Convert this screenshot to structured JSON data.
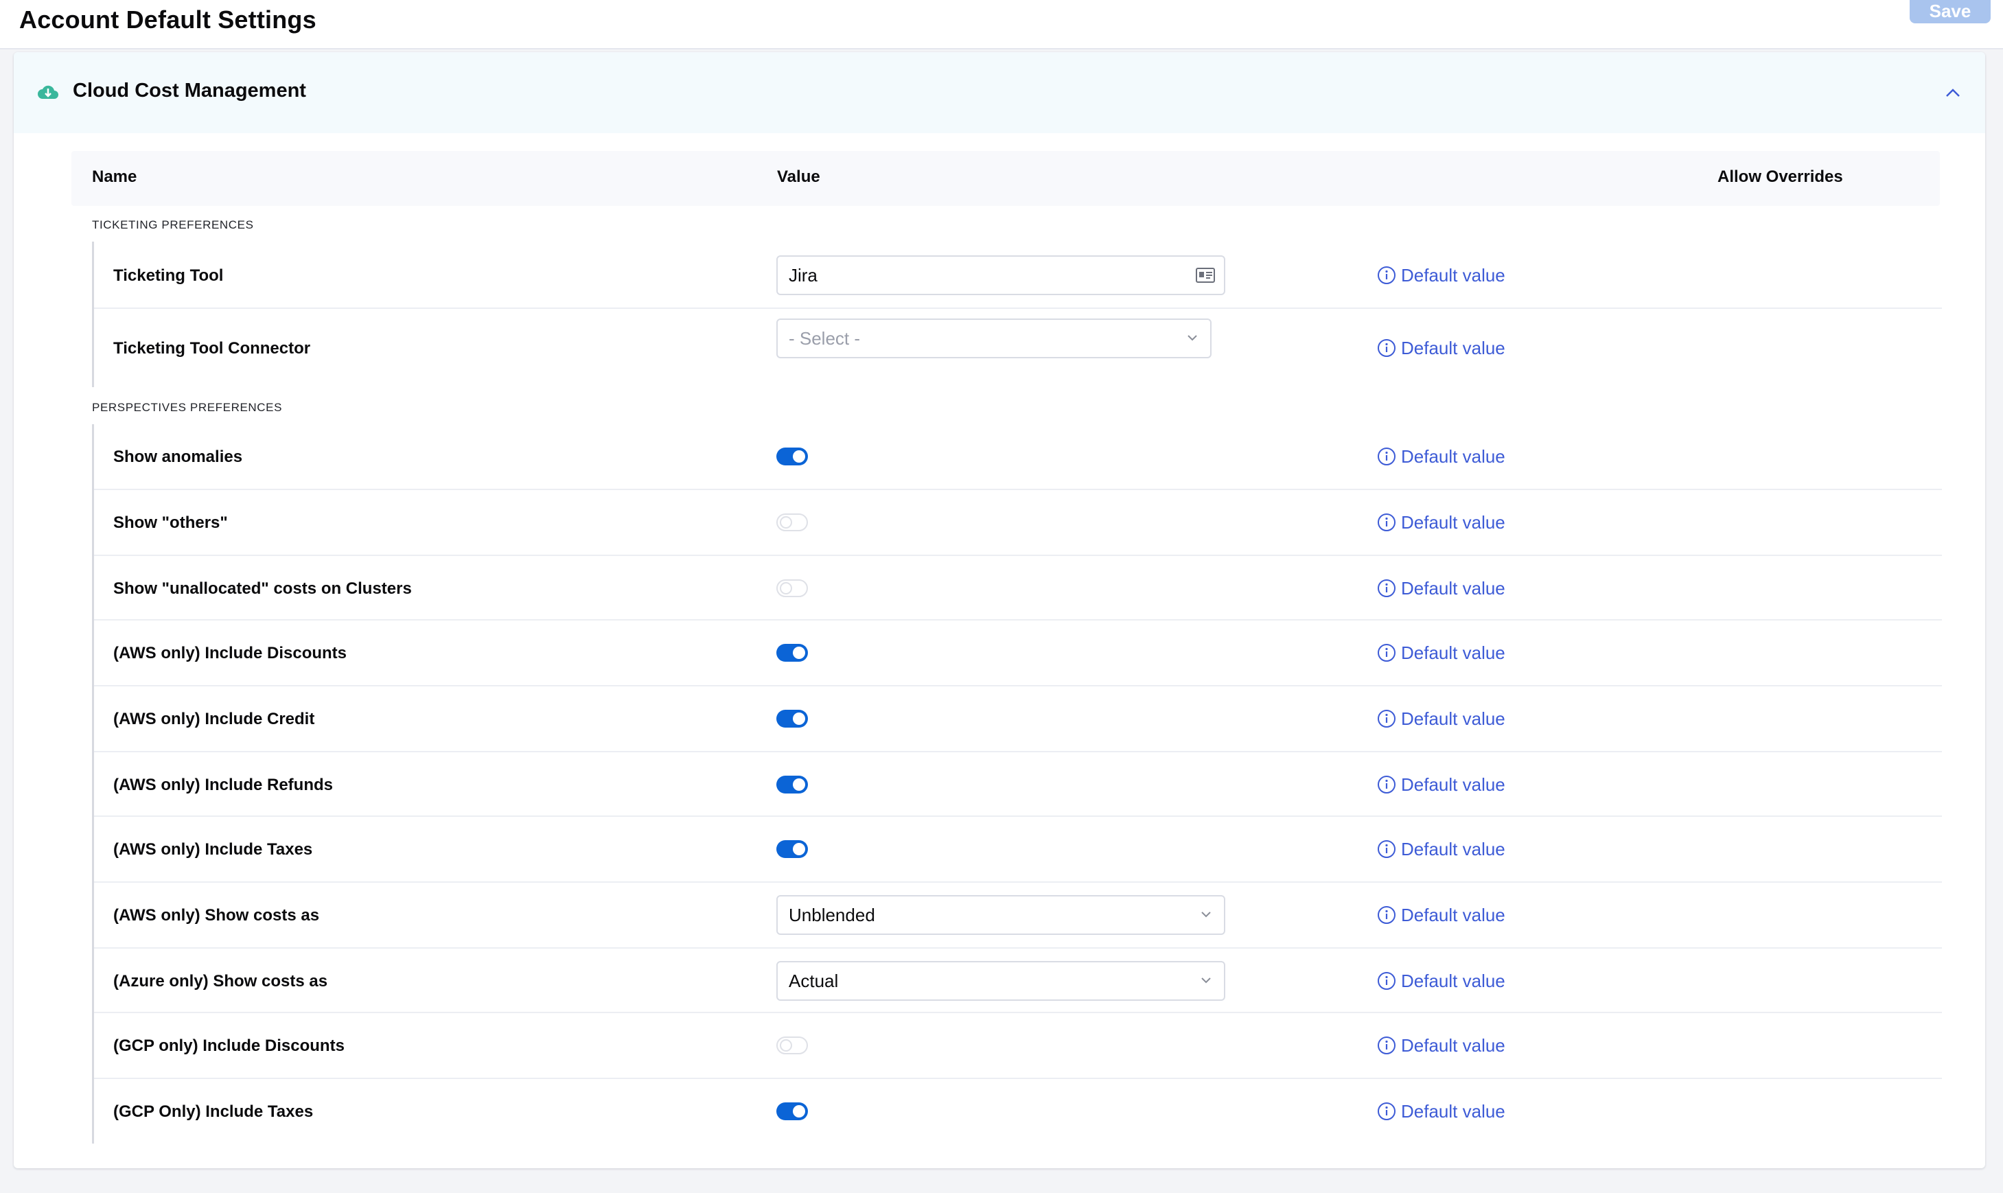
{
  "header": {
    "title": "Account Default Settings",
    "save_label": "Save"
  },
  "card": {
    "title": "Cloud Cost Management"
  },
  "table": {
    "columns": {
      "name": "Name",
      "value": "Value",
      "overrides": "Allow Overrides"
    }
  },
  "default_value_label": "Default value",
  "sections": {
    "ticketing": {
      "label": "TICKETING PREFERENCES",
      "rows": [
        {
          "name": "Ticketing Tool",
          "value": "Jira"
        },
        {
          "name": "Ticketing Tool Connector",
          "placeholder": "- Select -"
        }
      ]
    },
    "perspectives": {
      "label": "PERSPECTIVES PREFERENCES",
      "rows": [
        {
          "name": "Show anomalies",
          "enabled": true
        },
        {
          "name": "Show \"others\"",
          "enabled": false
        },
        {
          "name": "Show \"unallocated\" costs on Clusters",
          "enabled": false
        },
        {
          "name": "(AWS only) Include Discounts",
          "enabled": true
        },
        {
          "name": "(AWS only) Include Credit",
          "enabled": true
        },
        {
          "name": "(AWS only) Include Refunds",
          "enabled": true
        },
        {
          "name": "(AWS only) Include Taxes",
          "enabled": true
        },
        {
          "name": "(AWS only) Show costs as",
          "value": "Unblended"
        },
        {
          "name": "(Azure only) Show costs as",
          "value": "Actual"
        },
        {
          "name": "(GCP only) Include Discounts",
          "enabled": false
        },
        {
          "name": "(GCP Only) Include Taxes",
          "enabled": true
        }
      ]
    }
  },
  "icons": {
    "card": "cloud-cost-icon",
    "collapse": "chevron-up-icon",
    "info": "info-icon",
    "dropdown": "chevron-down-icon",
    "field_picker": "id-card-icon"
  },
  "colors": {
    "accent": "#0b64d6",
    "link": "#3d5bd6",
    "header_bg": "#f3fafd",
    "save_disabled": "#a9c4ee"
  }
}
